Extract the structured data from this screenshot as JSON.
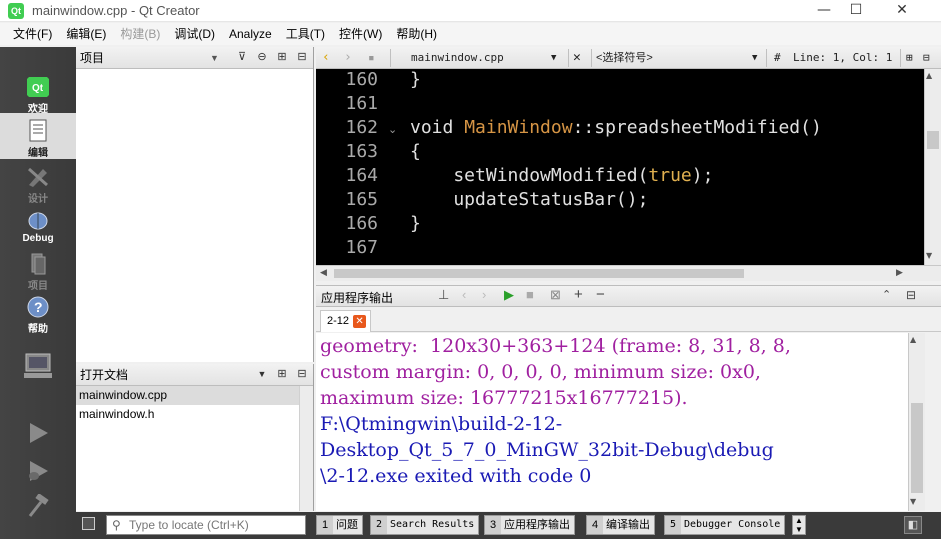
{
  "window": {
    "title": "mainwindow.cpp - Qt Creator",
    "app_icon_text": "Qt",
    "minimize": "—",
    "maximize": "☐",
    "close": "✕"
  },
  "menu": [
    "文件(F)",
    "编辑(E)",
    "构建(B)",
    "调试(D)",
    "Analyze",
    "工具(T)",
    "控件(W)",
    "帮助(H)"
  ],
  "modes": [
    {
      "label": "欢迎",
      "state": "normal"
    },
    {
      "label": "编辑",
      "state": "active"
    },
    {
      "label": "设计",
      "state": "disabled"
    },
    {
      "label": "Debug",
      "state": "normal"
    },
    {
      "label": "项目",
      "state": "disabled"
    },
    {
      "label": "帮助",
      "state": "normal"
    }
  ],
  "project_panel": {
    "title": "项目"
  },
  "open_docs": {
    "title": "打开文档",
    "files": [
      "mainwindow.cpp",
      "mainwindow.h"
    ]
  },
  "editor": {
    "file": "mainwindow.cpp",
    "symbol": "<选择符号>",
    "position": "Line: 1, Col: 1",
    "hash": "#",
    "line_numbers": [
      "160",
      "161",
      "162",
      "163",
      "164",
      "165",
      "166",
      "167"
    ],
    "lines": [
      {
        "num": "160",
        "text": "}"
      },
      {
        "num": "161",
        "text": ""
      },
      {
        "num": "162",
        "void": "void ",
        "class": "MainWindow",
        "rest": "::spreadsheetModified()"
      },
      {
        "num": "163",
        "text": "{"
      },
      {
        "num": "164",
        "pre": "    setWindowModified(",
        "lit": "true",
        "post": ");"
      },
      {
        "num": "165",
        "text": "    updateStatusBar();"
      },
      {
        "num": "166",
        "text": "}"
      },
      {
        "num": "167",
        "text": ""
      }
    ]
  },
  "output": {
    "title": "应用程序输出",
    "tab": "2-12",
    "lines_purple": [
      "geometry:  120x30+363+124 (frame: 8, 31, 8, 8,",
      "custom margin: 0, 0, 0, 0, minimum size: 0x0,",
      "maximum size: 16777215x16777215)."
    ],
    "lines_navy": [
      "F:\\Qtmingwin\\build-2-12-",
      "Desktop_Qt_5_7_0_MinGW_32bit-Debug\\debug",
      "\\2-12.exe exited with code 0"
    ]
  },
  "bottom": {
    "locator_placeholder": "Type to locate (Ctrl+K)",
    "tabs": [
      {
        "num": "1",
        "label": "问题"
      },
      {
        "num": "2",
        "label": "Search Results"
      },
      {
        "num": "3",
        "label": "应用程序输出"
      },
      {
        "num": "4",
        "label": "编译输出"
      },
      {
        "num": "5",
        "label": "Debugger Console"
      }
    ]
  }
}
